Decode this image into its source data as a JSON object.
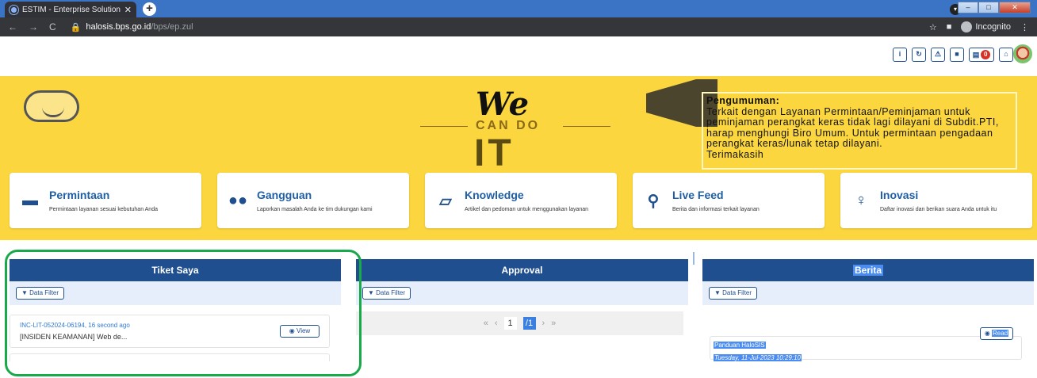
{
  "browser": {
    "tab_title": "ESTIM - Enterprise Solution for T",
    "new_tab": "+",
    "close_tab": "✕",
    "url_host": "halosis.bps.go.id",
    "url_path": "/bps/ep.zul",
    "incognito": "Incognito"
  },
  "header_icons": {
    "info": "i",
    "refresh": "↻",
    "warning": "⚠",
    "book": "■",
    "inbox_count": "0",
    "home": "⌂"
  },
  "banner": {
    "we": "We",
    "can_do": "CAN DO",
    "it": "IT",
    "announcement_title": "Pengumuman:",
    "announcement_text": "Terkait dengan Layanan Permintaan/Peminjaman untuk peminjaman perangkat keras tidak lagi dilayani di Subdit.PTI, harap menghungi Biro Umum. Untuk permintaan pengadaan perangkat keras/lunak tetap dilayani.",
    "announcement_end": "Terimakasih"
  },
  "cards": [
    {
      "title": "Permintaan",
      "sub": "Permintaan layanan sesuai kebutuhan Anda",
      "icon": "briefcase-icon"
    },
    {
      "title": "Gangguan",
      "sub": "Laporkan masalah Anda ke tim dukungan kami",
      "icon": "users-icon"
    },
    {
      "title": "Knowledge",
      "sub": "Artikel dan pedoman untuk menggunakan layanan",
      "icon": "book-icon"
    },
    {
      "title": "Live Feed",
      "sub": "Berita dan informasi terkait layanan",
      "icon": "rss-icon"
    },
    {
      "title": "Inovasi",
      "sub": "Daftar inovasi dan berikan suara Anda untuk itu",
      "icon": "lightbulb-icon"
    }
  ],
  "panels": {
    "tiket_title": "Tiket Saya",
    "approval_title": "Approval",
    "berita_title": "Berita",
    "filter_label": "Data Filter",
    "ticket_id": "INC-LIT-052024-06194, 16 second ago",
    "ticket_text": "[INSIDEN KEAMANAN] Web de...",
    "view_label": "View",
    "page_current": "1",
    "page_total": "/1",
    "news_title": "Panduan HaloSIS",
    "news_date": "Tuesday, 11-Jul-2023 10:29:10",
    "read_label": "Read"
  }
}
